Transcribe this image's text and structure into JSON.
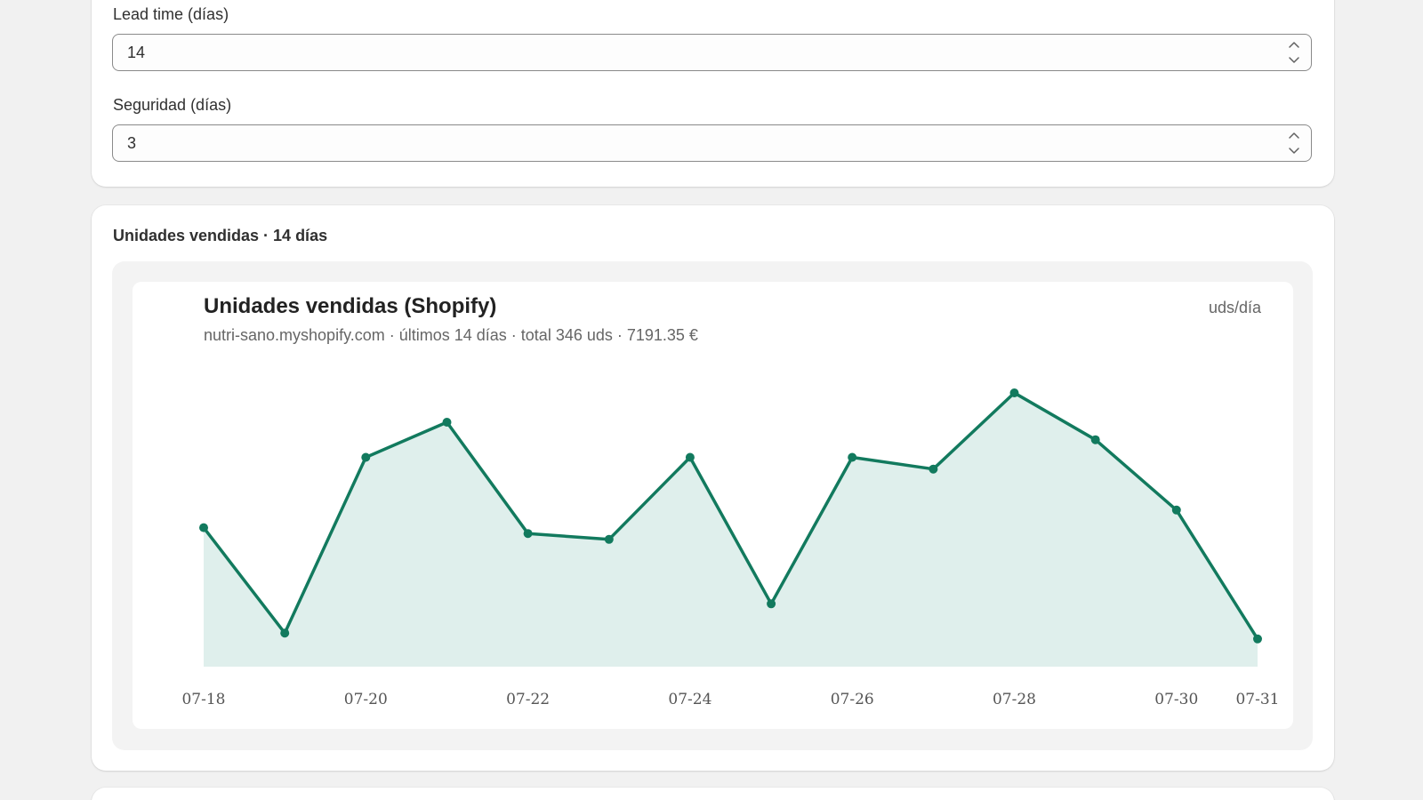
{
  "form": {
    "lead_time": {
      "label": "Lead time (días)",
      "value": "14"
    },
    "safety": {
      "label": "Seguridad (días)",
      "value": "3"
    }
  },
  "sales_card": {
    "heading": "Unidades vendidas · 14 días"
  },
  "chart_data": {
    "type": "area",
    "title": "Unidades vendidas (Shopify)",
    "subtitle": "nutri-sano.myshopify.com · últimos 14 días · total 346 uds · 7191.35 €",
    "unit_label": "uds/día",
    "x": [
      "07-18",
      "07-19",
      "07-20",
      "07-21",
      "07-22",
      "07-23",
      "07-24",
      "07-25",
      "07-26",
      "07-27",
      "07-28",
      "07-29",
      "07-30",
      "07-31"
    ],
    "tick_labels": [
      "07-18",
      "07-20",
      "07-22",
      "07-24",
      "07-26",
      "07-28",
      "07-30",
      "07-31"
    ],
    "values": [
      22,
      4,
      34,
      40,
      21,
      20,
      34,
      9,
      34,
      32,
      45,
      37,
      25,
      3
    ],
    "ylim": [
      1,
      45
    ],
    "grid": false,
    "colors": {
      "line": "#127a5e",
      "fill": "#dfefec"
    }
  }
}
